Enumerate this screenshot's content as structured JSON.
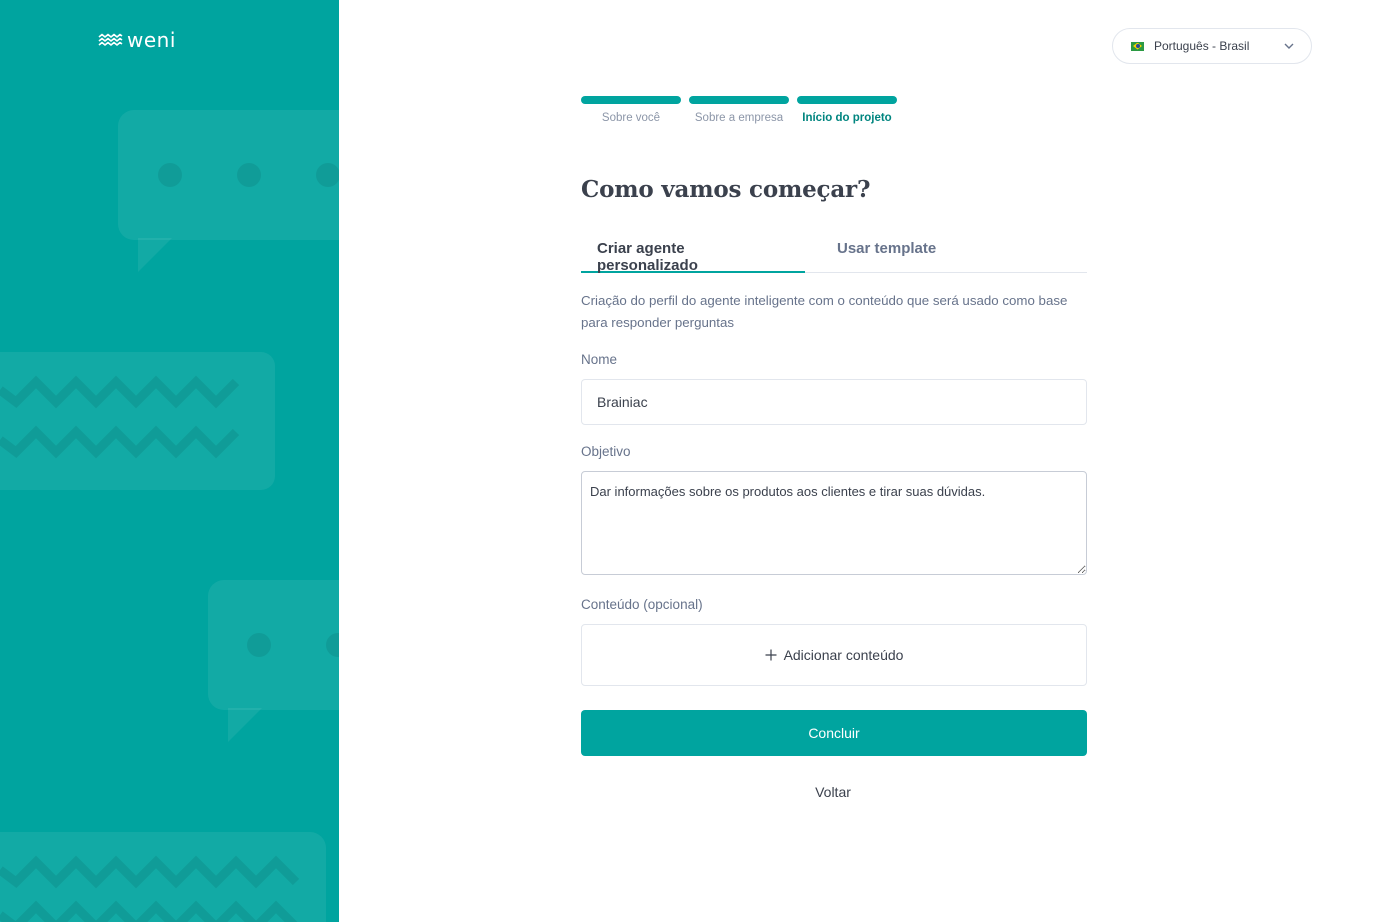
{
  "brand": {
    "logo_text": "weni",
    "primary_color": "#00a49f"
  },
  "language": {
    "selected": "Português - Brasil",
    "flag": "brazil-flag-icon"
  },
  "stepper": {
    "steps": [
      {
        "label": "Sobre você",
        "state": "done"
      },
      {
        "label": "Sobre a empresa",
        "state": "done"
      },
      {
        "label": "Início do projeto",
        "state": "current"
      }
    ]
  },
  "page": {
    "title": "Como vamos começar?"
  },
  "tabs": [
    {
      "label": "Criar agente personalizado",
      "active": true
    },
    {
      "label": "Usar template",
      "active": false
    }
  ],
  "form": {
    "description": "Criação do perfil do agente inteligente com o conteúdo que será usado como base para responder perguntas",
    "name_label": "Nome",
    "name_value": "Brainiac",
    "goal_label": "Objetivo",
    "goal_value": "Dar informações sobre os produtos aos clientes e tirar suas dúvidas.",
    "content_label": "Conteúdo (opcional)",
    "add_content_label": "Adicionar conteúdo"
  },
  "actions": {
    "submit_label": "Concluir",
    "back_label": "Voltar"
  }
}
